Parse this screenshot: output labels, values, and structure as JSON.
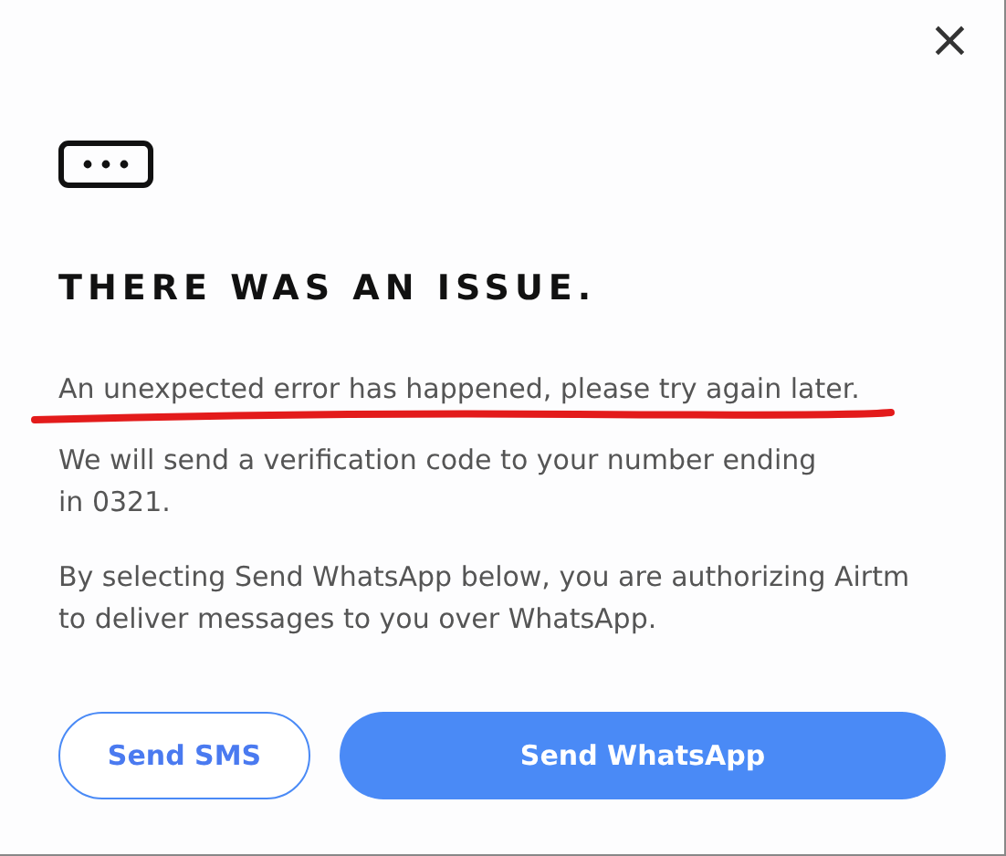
{
  "close_button": "×",
  "title": "THERE WAS AN ISSUE.",
  "error_message": {
    "text": "An unexpected error has happened, please try again later.",
    "underlined": true,
    "color": "#e31b1b"
  },
  "paragraphs": [
    "We will send a verification code to your number ending in 0321.",
    "By selecting Send WhatsApp below, you are authorizing Airtm to deliver messages to you over WhatsApp."
  ],
  "buttons": [
    {
      "label": "Send SMS",
      "kind": "outline"
    },
    {
      "label": "Send WhatsApp",
      "kind": "primary"
    }
  ]
}
